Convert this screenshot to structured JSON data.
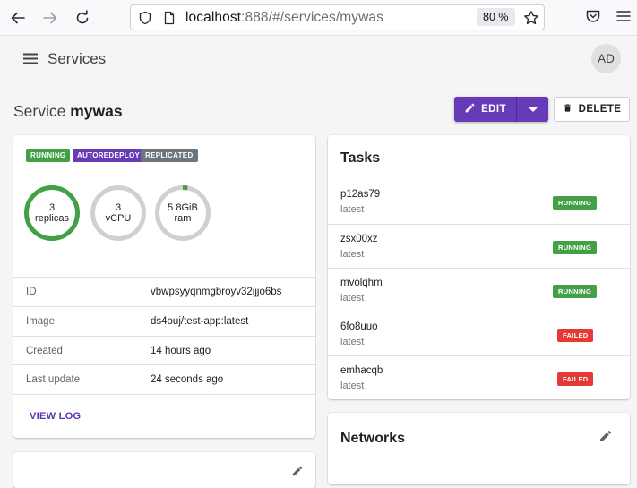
{
  "browser": {
    "url_host": "localhost",
    "url_rest": ":888/#/services/mywas",
    "zoom": "80 %"
  },
  "appbar": {
    "title": "Services",
    "avatar_initials": "AD"
  },
  "page": {
    "title_prefix": "Service",
    "service_name": "mywas",
    "edit_label": "EDIT",
    "delete_label": "DELETE"
  },
  "service_card": {
    "badges": [
      {
        "label": "RUNNING",
        "color": "#43a047"
      },
      {
        "label": "AUTOREDEPLOY",
        "color": "#673ab7"
      },
      {
        "label": "REPLICATED",
        "color": "#6c757d"
      }
    ],
    "gauges": [
      {
        "line1": "3",
        "line2": "replicas",
        "fill": 1.0
      },
      {
        "line1": "3",
        "line2": "vCPU",
        "fill": 0.0
      },
      {
        "line1": "5.8GiB",
        "line2": "ram",
        "fill": 0.03
      }
    ],
    "details": [
      {
        "key": "ID",
        "value": "vbwpsyyqnmgbroyv32ijjo6bs"
      },
      {
        "key": "Image",
        "value": "ds4ouj/test-app:latest"
      },
      {
        "key": "Created",
        "value": "14 hours ago"
      },
      {
        "key": "Last update",
        "value": "24 seconds ago"
      }
    ],
    "view_log_label": "VIEW LOG"
  },
  "tasks_card": {
    "title": "Tasks",
    "tasks": [
      {
        "name": "p12as79",
        "tag": "latest",
        "status": "RUNNING",
        "color": "#43a047"
      },
      {
        "name": "zsx00xz",
        "tag": "latest",
        "status": "RUNNING",
        "color": "#43a047"
      },
      {
        "name": "mvolqhm",
        "tag": "latest",
        "status": "RUNNING",
        "color": "#43a047"
      },
      {
        "name": "6fo8uuo",
        "tag": "latest",
        "status": "FAILED",
        "color": "#e53935"
      },
      {
        "name": "emhacqb",
        "tag": "latest",
        "status": "FAILED",
        "color": "#e53935"
      }
    ]
  },
  "networks_card": {
    "title": "Networks"
  },
  "colors": {
    "primary": "#673ab7",
    "success": "#43a047",
    "danger": "#e53935",
    "gauge_track": "#d0d0d0"
  }
}
